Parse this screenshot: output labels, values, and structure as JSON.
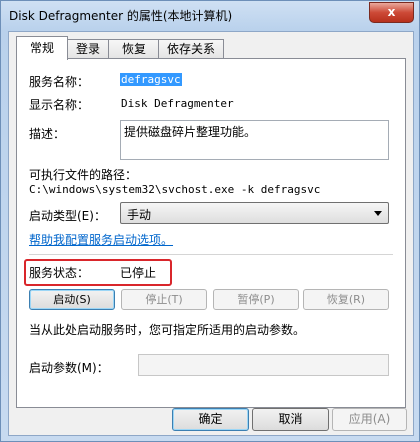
{
  "window": {
    "title": "Disk Defragmenter 的属性(本地计算机)",
    "close_glyph": "x"
  },
  "tabs": [
    {
      "label": "常规"
    },
    {
      "label": "登录"
    },
    {
      "label": "恢复"
    },
    {
      "label": "依存关系"
    }
  ],
  "general": {
    "service_name_label": "服务名称：",
    "service_name_value": "defragsvc",
    "display_name_label": "显示名称：",
    "display_name_value": "Disk Defragmenter",
    "description_label": "描述：",
    "description_value": "提供磁盘碎片整理功能。",
    "exec_path_label": "可执行文件的路径：",
    "exec_path_value": "C:\\windows\\system32\\svchost.exe -k defragsvc",
    "startup_type_label": "启动类型(E)：",
    "startup_type_value": "手动",
    "help_link": "帮助我配置服务启动选项。",
    "status_label": "服务状态：",
    "status_value": "已停止",
    "buttons": {
      "start": "启动(S)",
      "stop": "停止(T)",
      "pause": "暂停(P)",
      "resume": "恢复(R)"
    },
    "hint": "当从此处启动服务时，您可指定所适用的启动参数。",
    "start_params_label": "启动参数(M)：",
    "start_params_value": ""
  },
  "dialog_buttons": {
    "ok": "确定",
    "cancel": "取消",
    "apply": "应用(A)"
  },
  "colors": {
    "highlight_border": "#d9262b",
    "link": "#0066cc",
    "selection": "#3399ff"
  }
}
